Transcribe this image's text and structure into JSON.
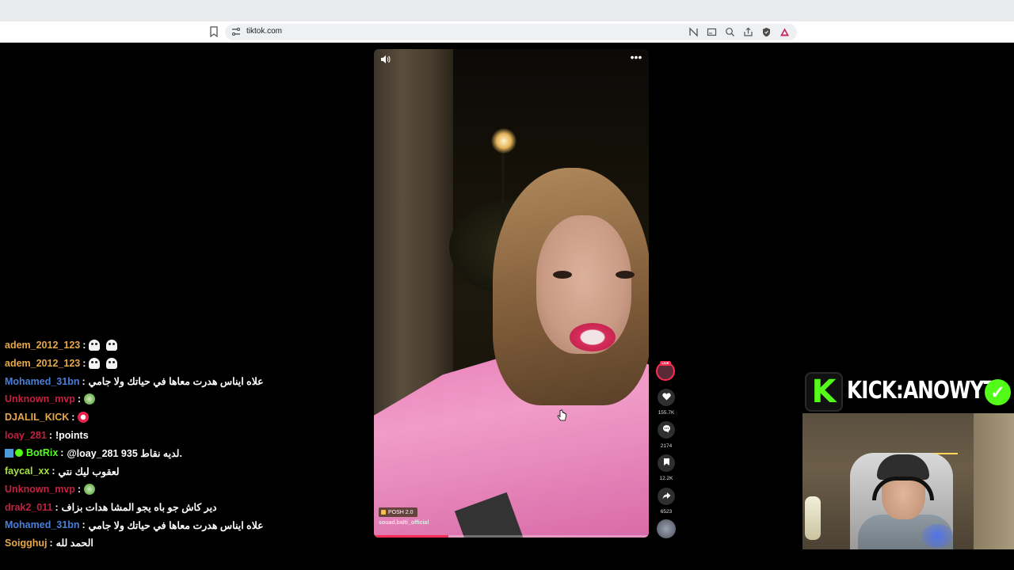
{
  "browser": {
    "url": "tiktok.com",
    "toolbar_icons": [
      "bookmark-icon",
      "site-settings-icon",
      "translate-icon",
      "cast-icon",
      "zoom-icon",
      "share-icon",
      "brave-shield-icon",
      "brave-rewards-icon"
    ]
  },
  "video": {
    "music_label": "POSH 2.0",
    "author": "souad.balti_official",
    "progress_percent": 27
  },
  "actions": {
    "live_badge": "LIVE",
    "likes": "155.7K",
    "comments": "2174",
    "saves": "12.2K",
    "shares": "6523"
  },
  "chat": [
    {
      "user": "adem_2012_123",
      "color": "#e7a845",
      "message": "",
      "emotes": [
        "ghost",
        "ghost"
      ]
    },
    {
      "user": "adem_2012_123",
      "color": "#e7a845",
      "message": "",
      "emotes": [
        "ghost",
        "ghost"
      ]
    },
    {
      "user": "Mohamed_31bn",
      "color": "#4b7fd6",
      "message": "علاه ايناس هدرت معاها في حياتك ولا جامي",
      "emotes": []
    },
    {
      "user": "Unknown_mvp",
      "color": "#c2223f",
      "message": "",
      "emotes": [
        "green"
      ]
    },
    {
      "user": "DJALIL_KICK",
      "color": "#e7a845",
      "message": "",
      "emotes": [
        "red"
      ]
    },
    {
      "user": "loay_281",
      "color": "#c2223f",
      "message": "!points",
      "emotes": []
    },
    {
      "user": "BotRix",
      "color": "#53fc18",
      "message": "@loay_281 935 لديه نقاط.",
      "emotes": [],
      "badges": true
    },
    {
      "user": "faycal_xx",
      "color": "#a5e23c",
      "message": "لعقوب ليك نتي",
      "emotes": []
    },
    {
      "user": "Unknown_mvp",
      "color": "#c2223f",
      "message": "",
      "emotes": [
        "green"
      ]
    },
    {
      "user": "drak2_011",
      "color": "#c2223f",
      "message": "دير كاش جو باه يجو المشا هدات بزاف",
      "emotes": []
    },
    {
      "user": "Mohamed_31bn",
      "color": "#4b7fd6",
      "message": "علاه ايناس هدرت معاها في حياتك ولا جامي",
      "emotes": []
    },
    {
      "user": "Soigghuj",
      "color": "#e7a845",
      "message": "الحمد لله",
      "emotes": []
    }
  ],
  "overlay": {
    "channel_text": "KICK:ANOWYT",
    "logo_letter": "K",
    "verified_glyph": "✓"
  }
}
